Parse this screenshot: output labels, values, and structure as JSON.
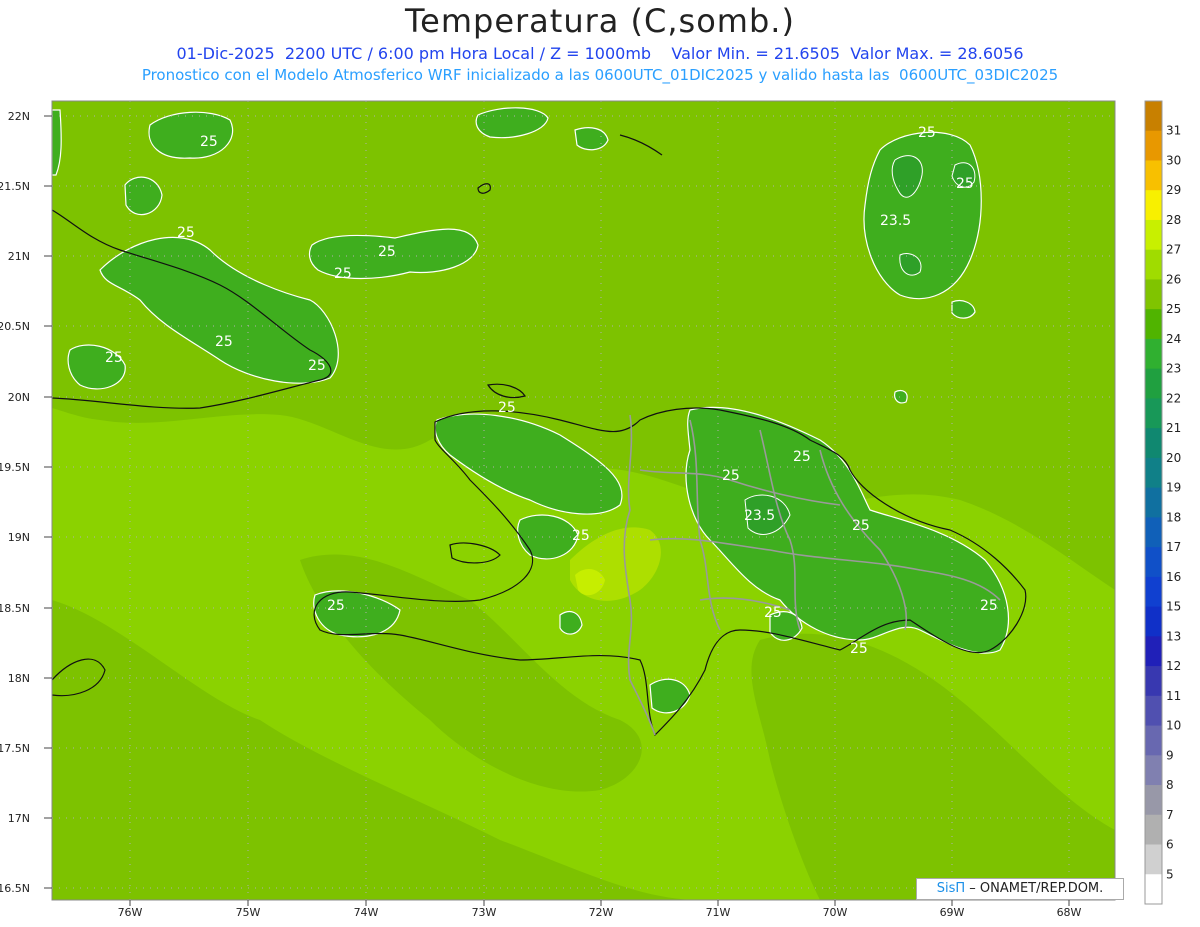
{
  "header": {
    "title": "Temperatura (C,somb.)",
    "subtitle_line1": "01-Dic-2025  2200 UTC / 6:00 pm Hora Local / Z = 1000mb    Valor Min. = 21.6505  Valor Max. = 28.6056",
    "subtitle_line2": "Pronostico con el Modelo Atmosferico WRF inicializado a las 0600UTC_01DIC2025 y valido hasta las  0600UTC_03DIC2025"
  },
  "axes": {
    "lat_labels": [
      "22N",
      "21.5N",
      "21N",
      "20.5N",
      "20N",
      "19.5N",
      "19N",
      "18.5N",
      "18N",
      "17.5N",
      "17N",
      "16.5N"
    ],
    "lon_labels": [
      "76W",
      "75W",
      "74W",
      "73W",
      "72W",
      "71W",
      "70W",
      "69W",
      "68W"
    ]
  },
  "contour_labels": [
    "25",
    "25",
    "25",
    "25",
    "25",
    "25",
    "25",
    "25",
    "25",
    "25",
    "25",
    "25",
    "25",
    "25",
    "25",
    "23.5",
    "23.5",
    "25",
    "25",
    "25"
  ],
  "colorbar": {
    "labels": [
      "31",
      "30",
      "29",
      "28",
      "27",
      "26",
      "25",
      "24",
      "23",
      "22",
      "21",
      "20",
      "19",
      "18",
      "17",
      "16",
      "15",
      "13",
      "12",
      "11",
      "10",
      "9",
      "8",
      "7",
      "6",
      "5"
    ],
    "colors": [
      "#c88000",
      "#e89800",
      "#f8c000",
      "#f8f000",
      "#c8f000",
      "#a0dc00",
      "#80c400",
      "#50b400",
      "#30b030",
      "#20a040",
      "#189858",
      "#108870",
      "#108088",
      "#1070a0",
      "#1060b8",
      "#1050c8",
      "#1040d0",
      "#1030c8",
      "#2020b8",
      "#3838b0",
      "#5050b0",
      "#6868b0",
      "#8080b0",
      "#9898a8",
      "#b0b0b0",
      "#d0d0d0",
      "#ffffff"
    ]
  },
  "credit": {
    "brand": "SisΠ",
    "text": "– ONAMET/REP.DOM."
  }
}
